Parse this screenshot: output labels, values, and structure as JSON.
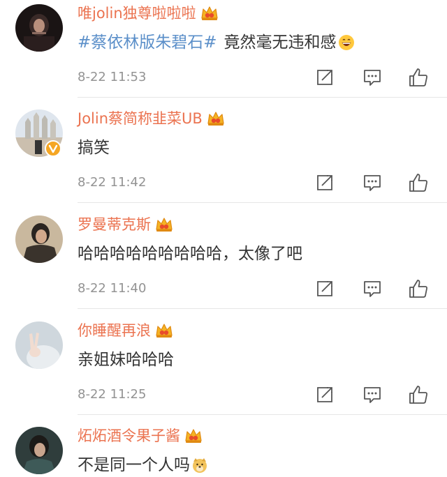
{
  "comments": [
    {
      "username": "唯jolin独尊啦啦啦",
      "topic": "#蔡依林版朱碧石#",
      "text": "竟然毫无违和感",
      "time": "8-22 11:53",
      "emoji": "grinning-emoji",
      "verified": false
    },
    {
      "username": "Jolin蔡简称韭菜UB",
      "topic": "",
      "text": "搞笑",
      "time": "8-22 11:42",
      "verified": true
    },
    {
      "username": "罗曼蒂克斯",
      "topic": "",
      "text": "哈哈哈哈哈哈哈哈哈，太像了吧",
      "time": "8-22 11:40",
      "verified": false
    },
    {
      "username": "你睡醒再浪",
      "topic": "",
      "text": "亲姐妹哈哈哈",
      "time": "8-22 11:25",
      "verified": false
    },
    {
      "username": "炻炻酒令果子酱",
      "topic": "",
      "text": "不是同一个人吗",
      "time": "",
      "emoji": "doge-emoji",
      "verified": false
    }
  ],
  "icons": {
    "badge": "crown-vip-icon",
    "share": "share-icon",
    "comment": "comment-icon",
    "like": "thumbs-up-icon",
    "verified": "verified-badge-icon"
  },
  "colors": {
    "username": "#eb7350",
    "topic": "#5b8fc9",
    "text": "#333333",
    "meta": "#939393",
    "divider": "#e6e6e6"
  }
}
